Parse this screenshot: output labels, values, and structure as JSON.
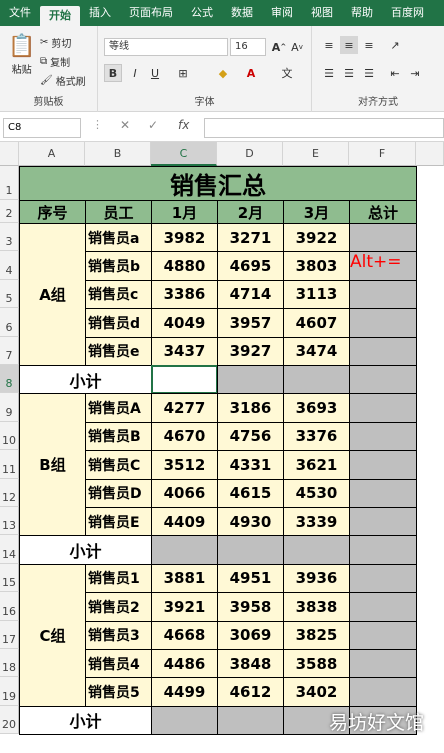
{
  "tabs": [
    "文件",
    "开始",
    "插入",
    "页面布局",
    "公式",
    "数据",
    "审阅",
    "视图",
    "帮助",
    "百度网"
  ],
  "active_tab": "开始",
  "ribbon": {
    "paste_label": "粘贴",
    "cut_label": "剪切",
    "copy_label": "复制",
    "format_painter_label": "格式刷",
    "clipboard_group": "剪贴板",
    "font_name": "等线",
    "font_size": "16",
    "font_group": "字体",
    "align_group": "对齐方式",
    "bold": "B",
    "italic": "I",
    "underline": "U"
  },
  "formula_bar": {
    "name_box": "C8",
    "fx": "fx",
    "content": ""
  },
  "columns": [
    "A",
    "B",
    "C",
    "D",
    "E",
    "F"
  ],
  "rows": [
    "1",
    "2",
    "3",
    "4",
    "5",
    "6",
    "7",
    "8",
    "9",
    "10",
    "11",
    "12",
    "13",
    "14",
    "15",
    "16",
    "17",
    "18",
    "19",
    "20"
  ],
  "sheet": {
    "title": "销售汇总",
    "headers": [
      "序号",
      "员工",
      "1月",
      "2月",
      "3月",
      "总计"
    ],
    "groups": [
      {
        "name": "A组",
        "rows": [
          {
            "employee": "销售员a",
            "m1": "3982",
            "m2": "3271",
            "m3": "3922"
          },
          {
            "employee": "销售员b",
            "m1": "4880",
            "m2": "4695",
            "m3": "3803"
          },
          {
            "employee": "销售员c",
            "m1": "3386",
            "m2": "4714",
            "m3": "3113"
          },
          {
            "employee": "销售员d",
            "m1": "4049",
            "m2": "3957",
            "m3": "4607"
          },
          {
            "employee": "销售员e",
            "m1": "3437",
            "m2": "3927",
            "m3": "3474"
          }
        ],
        "subtotal": "小计"
      },
      {
        "name": "B组",
        "rows": [
          {
            "employee": "销售员A",
            "m1": "4277",
            "m2": "3186",
            "m3": "3693"
          },
          {
            "employee": "销售员B",
            "m1": "4670",
            "m2": "4756",
            "m3": "3376"
          },
          {
            "employee": "销售员C",
            "m1": "3512",
            "m2": "4331",
            "m3": "3621"
          },
          {
            "employee": "销售员D",
            "m1": "4066",
            "m2": "4615",
            "m3": "4530"
          },
          {
            "employee": "销售员E",
            "m1": "4409",
            "m2": "4930",
            "m3": "3339"
          }
        ],
        "subtotal": "小计"
      },
      {
        "name": "C组",
        "rows": [
          {
            "employee": "销售员1",
            "m1": "3881",
            "m2": "4951",
            "m3": "3936"
          },
          {
            "employee": "销售员2",
            "m1": "3921",
            "m2": "3958",
            "m3": "3838"
          },
          {
            "employee": "销售员3",
            "m1": "4668",
            "m2": "3069",
            "m3": "3825"
          },
          {
            "employee": "销售员4",
            "m1": "4486",
            "m2": "3848",
            "m3": "3588"
          },
          {
            "employee": "销售员5",
            "m1": "4499",
            "m2": "4612",
            "m3": "3402"
          }
        ],
        "subtotal": "小计"
      }
    ]
  },
  "annotation": "Alt+=",
  "watermark": "易坊好文馆",
  "colors": {
    "ribbon_green": "#217346",
    "header_fill": "#8fbc8f",
    "data_fill": "#fff9d6",
    "sum_fill": "#bfbfbf",
    "annotation": "#ff0000"
  }
}
